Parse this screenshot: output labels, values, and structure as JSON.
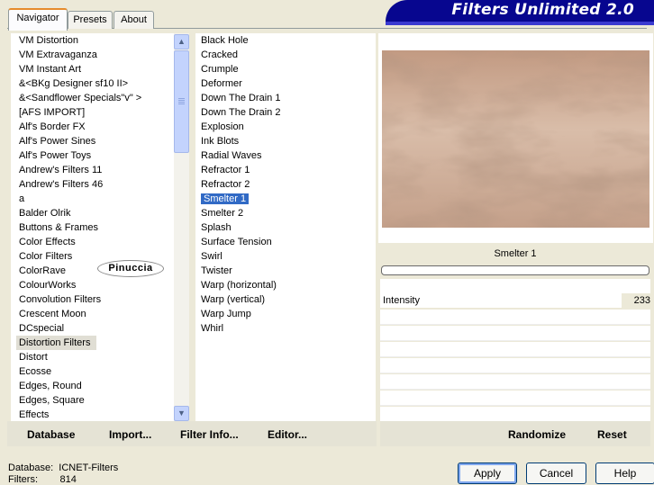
{
  "tabs": [
    {
      "label": "Navigator",
      "active": true
    },
    {
      "label": "Presets",
      "active": false
    },
    {
      "label": "About",
      "active": false
    }
  ],
  "banner": {
    "title": "Filters Unlimited 2.0"
  },
  "categories": [
    "VM Distortion",
    "VM Extravaganza",
    "VM Instant Art",
    "&<BKg Designer sf10 II>",
    "&<Sandflower Specials\"v\" >",
    "[AFS IMPORT]",
    "Alf's Border FX",
    "Alf's Power Sines",
    "Alf's Power Toys",
    "Andrew's Filters 11",
    "Andrew's Filters 46",
    "a",
    "Balder Olrik",
    "Buttons & Frames",
    "Color Effects",
    "Color Filters",
    "ColorRave",
    "ColourWorks",
    "Convolution Filters",
    "Crescent Moon",
    "DCspecial",
    "Distortion Filters",
    "Distort",
    "Ecosse",
    "Edges, Round",
    "Edges, Square",
    "Effects"
  ],
  "selected_category": "Distortion Filters",
  "filters": [
    "Black Hole",
    "Cracked",
    "Crumple",
    "Deformer",
    "Down The Drain 1",
    "Down The Drain 2",
    "Explosion",
    "Ink Blots",
    "Radial Waves",
    "Refractor 1",
    "Refractor 2",
    "Smelter 1",
    "Smelter 2",
    "Splash",
    "Surface Tension",
    "Swirl",
    "Twister",
    "Warp (horizontal)",
    "Warp (vertical)",
    "Warp Jump",
    "Whirl"
  ],
  "selected_filter": "Smelter 1",
  "watermark": "Pinuccia",
  "left_buttons": {
    "database": "Database",
    "import": "Import...",
    "filter_info": "Filter Info...",
    "editor": "Editor..."
  },
  "right_buttons": {
    "randomize": "Randomize",
    "reset": "Reset"
  },
  "preview": {
    "filter_name": "Smelter 1"
  },
  "control": {
    "label": "Intensity",
    "value": "233"
  },
  "status": {
    "database_label": "Database:",
    "database_value": "ICNET-Filters",
    "filters_label": "Filters:",
    "filters_value": "814"
  },
  "dialog_buttons": {
    "apply": "Apply",
    "cancel": "Cancel",
    "help": "Help"
  }
}
